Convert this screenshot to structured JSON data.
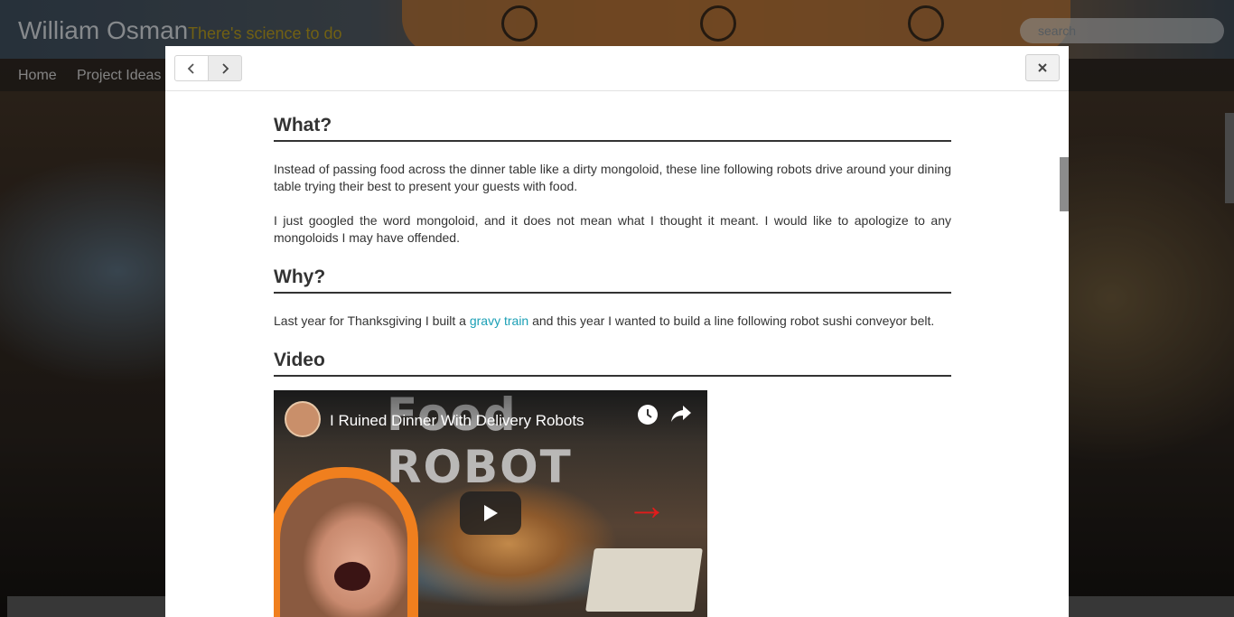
{
  "site": {
    "title": "William Osman",
    "tagline": "There's science to do",
    "search_placeholder": "search",
    "nav": [
      "Home",
      "Project Ideas"
    ]
  },
  "modal": {
    "prev_icon": "chevron-left-icon",
    "next_icon": "chevron-right-icon",
    "close_icon": "close-icon",
    "sections": {
      "what_heading": "What?",
      "what_p1": "Instead of passing food across the dinner table like a dirty mongoloid, these line following robots drive around your dining table trying their best to present your guests with food.",
      "what_p2": "I just googled the word mongoloid, and it does not mean what I thought it meant. I would like to apologize to any mongoloids I may have offended.",
      "why_heading": "Why?",
      "why_text_before": "Last year for Thanksgiving I built a ",
      "why_link": "gravy train",
      "why_text_after": " and this year I wanted to build a line following robot sushi conveyor belt.",
      "video_heading": "Video"
    },
    "video": {
      "title": "I Ruined Dinner With Delivery Robots",
      "thumbnail_text": "Food ROBOT",
      "arrow_glyph": "→"
    }
  },
  "colors": {
    "link": "#1a9fb5",
    "tagline": "#b69b20",
    "heading": "#333333"
  }
}
